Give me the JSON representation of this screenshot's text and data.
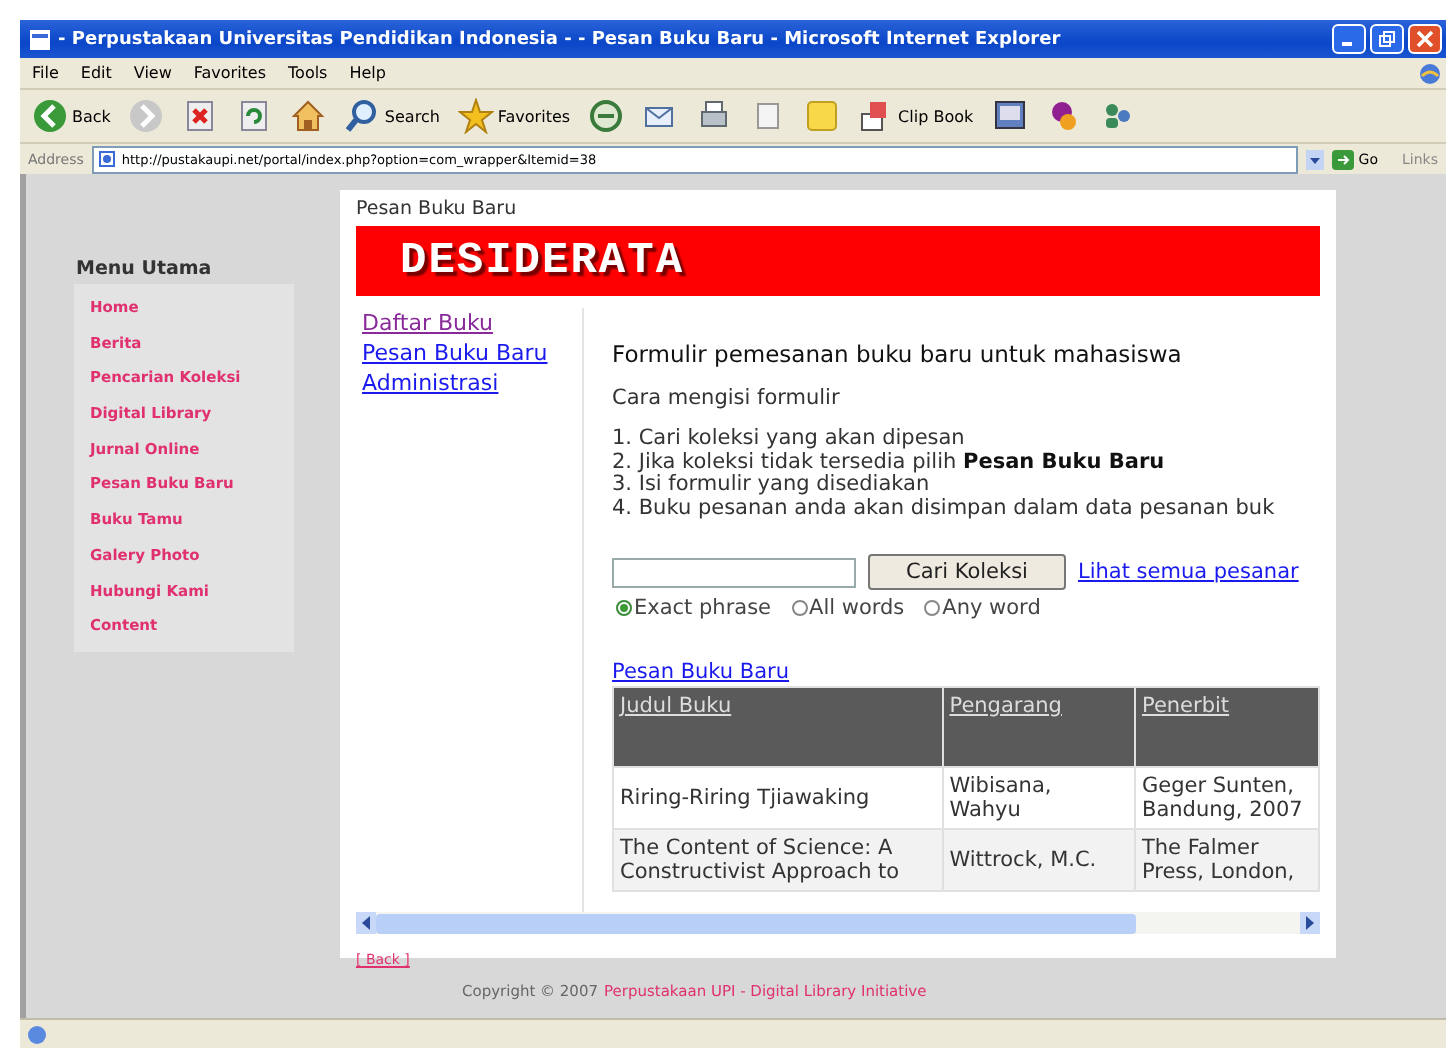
{
  "window": {
    "title": "- Perpustakaan Universitas Pendidikan Indonesia - - Pesan Buku Baru - Microsoft Internet Explorer"
  },
  "menu_bar": [
    "File",
    "Edit",
    "View",
    "Favorites",
    "Tools",
    "Help"
  ],
  "toolbar": [
    {
      "kind": "back",
      "label": "Back"
    },
    {
      "kind": "forward"
    },
    {
      "kind": "stop"
    },
    {
      "kind": "refresh"
    },
    {
      "kind": "home"
    },
    {
      "kind": "search",
      "label": "Search"
    },
    {
      "kind": "favorites",
      "label": "Favorites"
    },
    {
      "kind": "media"
    },
    {
      "kind": "mail"
    },
    {
      "kind": "print"
    },
    {
      "kind": "edit"
    },
    {
      "kind": "note"
    },
    {
      "kind": "clip",
      "label": "Clip Book"
    },
    {
      "kind": "screen"
    },
    {
      "kind": "messenger"
    },
    {
      "kind": "people"
    }
  ],
  "address_bar": {
    "label": "Address",
    "url": "http://pustakaupi.net/portal/index.php?option=com_wrapper&Itemid=38",
    "go": "Go",
    "links": "Links"
  },
  "sidebar": {
    "title": "Menu Utama",
    "items": [
      "Home",
      "Berita",
      "Pencarian Koleksi",
      "Digital Library",
      "Jurnal Online",
      "Pesan Buku Baru",
      "Buku Tamu",
      "Galery Photo",
      "Hubungi Kami",
      "Content"
    ]
  },
  "breadcrumb": "Pesan Buku Baru",
  "banner": "DESIDERATA",
  "nav_links": [
    {
      "label": "Daftar Buku",
      "visited": true
    },
    {
      "label": "Pesan Buku Baru",
      "visited": false
    },
    {
      "label": "Administrasi",
      "visited": false
    }
  ],
  "form": {
    "heading": "Formulir pemesanan buku baru untuk mahasiswa",
    "subheading": "Cara mengisi formulir",
    "steps": [
      "1. Cari koleksi yang akan dipesan",
      "2. Jika koleksi tidak tersedia pilih **Pesan Buku Baru**",
      "3. Isi formulir yang disediakan",
      "4. Buku pesanan anda akan disimpan dalam data pesanan buk"
    ],
    "search_button": "Cari Koleksi",
    "all_link": "Lihat semua pesanar",
    "options": [
      {
        "label": "Exact phrase",
        "selected": true
      },
      {
        "label": "All words",
        "selected": false
      },
      {
        "label": "Any word",
        "selected": false
      }
    ]
  },
  "table_link": "Pesan Buku Baru",
  "table": {
    "columns": [
      "Judul Buku",
      "Pengarang",
      "Penerbit"
    ],
    "rows": [
      [
        "Riring-Riring Tjiawaking",
        "Wibisana, Wahyu",
        "Geger Sunten, Bandung, 2007"
      ],
      [
        "The Content of Science: A Constructivist Approach to",
        "Wittrock, M.C.",
        "The Falmer Press, London,"
      ]
    ]
  },
  "back_link": "[ Back ]",
  "footer": {
    "text": "Copyright © 2007",
    "link": "Perpustakaan UPI - Digital Library Initiative"
  }
}
